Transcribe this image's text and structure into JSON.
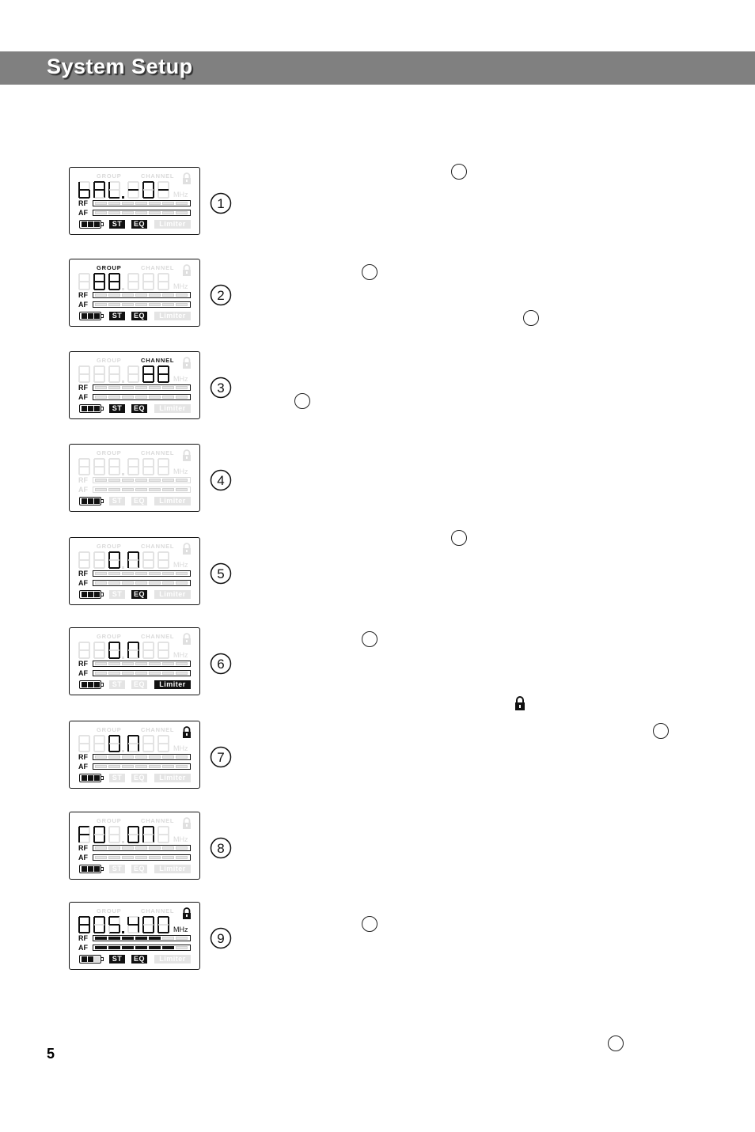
{
  "header": {
    "title": "System Setup",
    "band_color": "#808080"
  },
  "page_number": "5",
  "lcd_labels": {
    "group": "GROUP",
    "channel": "CHANNEL",
    "mhz": "MHz",
    "rf": "RF",
    "af": "AF",
    "st": "ST",
    "eq": "EQ",
    "limiter": "Limiter"
  },
  "displays": [
    {
      "step": "1",
      "text": "bAL.-0-",
      "group_on": false,
      "channel_on": false,
      "lock_on": false,
      "mhz_on": false,
      "rf_on": true,
      "af_on": true,
      "rf_level": 0,
      "af_level": 0,
      "battery": 3,
      "st_on": true,
      "eq_on": true,
      "limiter_on": false
    },
    {
      "step": "2",
      "text": "88 (group)",
      "group_on": true,
      "channel_on": false,
      "lock_on": false,
      "mhz_on": false,
      "rf_on": true,
      "af_on": true,
      "rf_level": 0,
      "af_level": 0,
      "battery": 3,
      "st_on": true,
      "eq_on": true,
      "limiter_on": false
    },
    {
      "step": "3",
      "text": "88 (channel)",
      "group_on": false,
      "channel_on": true,
      "lock_on": false,
      "mhz_on": false,
      "rf_on": true,
      "af_on": true,
      "rf_level": 0,
      "af_level": 0,
      "battery": 3,
      "st_on": true,
      "eq_on": true,
      "limiter_on": false
    },
    {
      "step": "4",
      "text": "",
      "group_on": false,
      "channel_on": false,
      "lock_on": false,
      "mhz_on": false,
      "rf_on": false,
      "af_on": false,
      "rf_level": 0,
      "af_level": 0,
      "battery": 3,
      "st_on": false,
      "eq_on": false,
      "limiter_on": false
    },
    {
      "step": "5",
      "text": "On",
      "group_on": false,
      "channel_on": false,
      "lock_on": false,
      "mhz_on": false,
      "rf_on": true,
      "af_on": true,
      "rf_level": 0,
      "af_level": 0,
      "battery": 3,
      "st_on": false,
      "eq_on": true,
      "limiter_on": false
    },
    {
      "step": "6",
      "text": "On",
      "group_on": false,
      "channel_on": false,
      "lock_on": false,
      "mhz_on": false,
      "rf_on": true,
      "af_on": true,
      "rf_level": 0,
      "af_level": 0,
      "battery": 3,
      "st_on": false,
      "eq_on": false,
      "limiter_on": true
    },
    {
      "step": "7",
      "text": "On",
      "group_on": false,
      "channel_on": false,
      "lock_on": true,
      "mhz_on": false,
      "rf_on": true,
      "af_on": true,
      "rf_level": 0,
      "af_level": 0,
      "battery": 3,
      "st_on": false,
      "eq_on": false,
      "limiter_on": false
    },
    {
      "step": "8",
      "text": "F0 On",
      "group_on": false,
      "channel_on": false,
      "lock_on": false,
      "mhz_on": false,
      "rf_on": true,
      "af_on": true,
      "rf_level": 0,
      "af_level": 0,
      "battery": 3,
      "st_on": false,
      "eq_on": false,
      "limiter_on": false
    },
    {
      "step": "9",
      "text": "805.400",
      "group_on": false,
      "channel_on": false,
      "lock_on": true,
      "mhz_on": true,
      "rf_on": true,
      "af_on": true,
      "rf_level": 5,
      "af_level": 6,
      "battery": 2,
      "st_on": true,
      "eq_on": true,
      "limiter_on": false
    }
  ],
  "bar_segments": 7,
  "battery_cells": 3,
  "step_circles": [
    "1",
    "2",
    "3",
    "4",
    "5",
    "6",
    "7",
    "8",
    "9"
  ]
}
